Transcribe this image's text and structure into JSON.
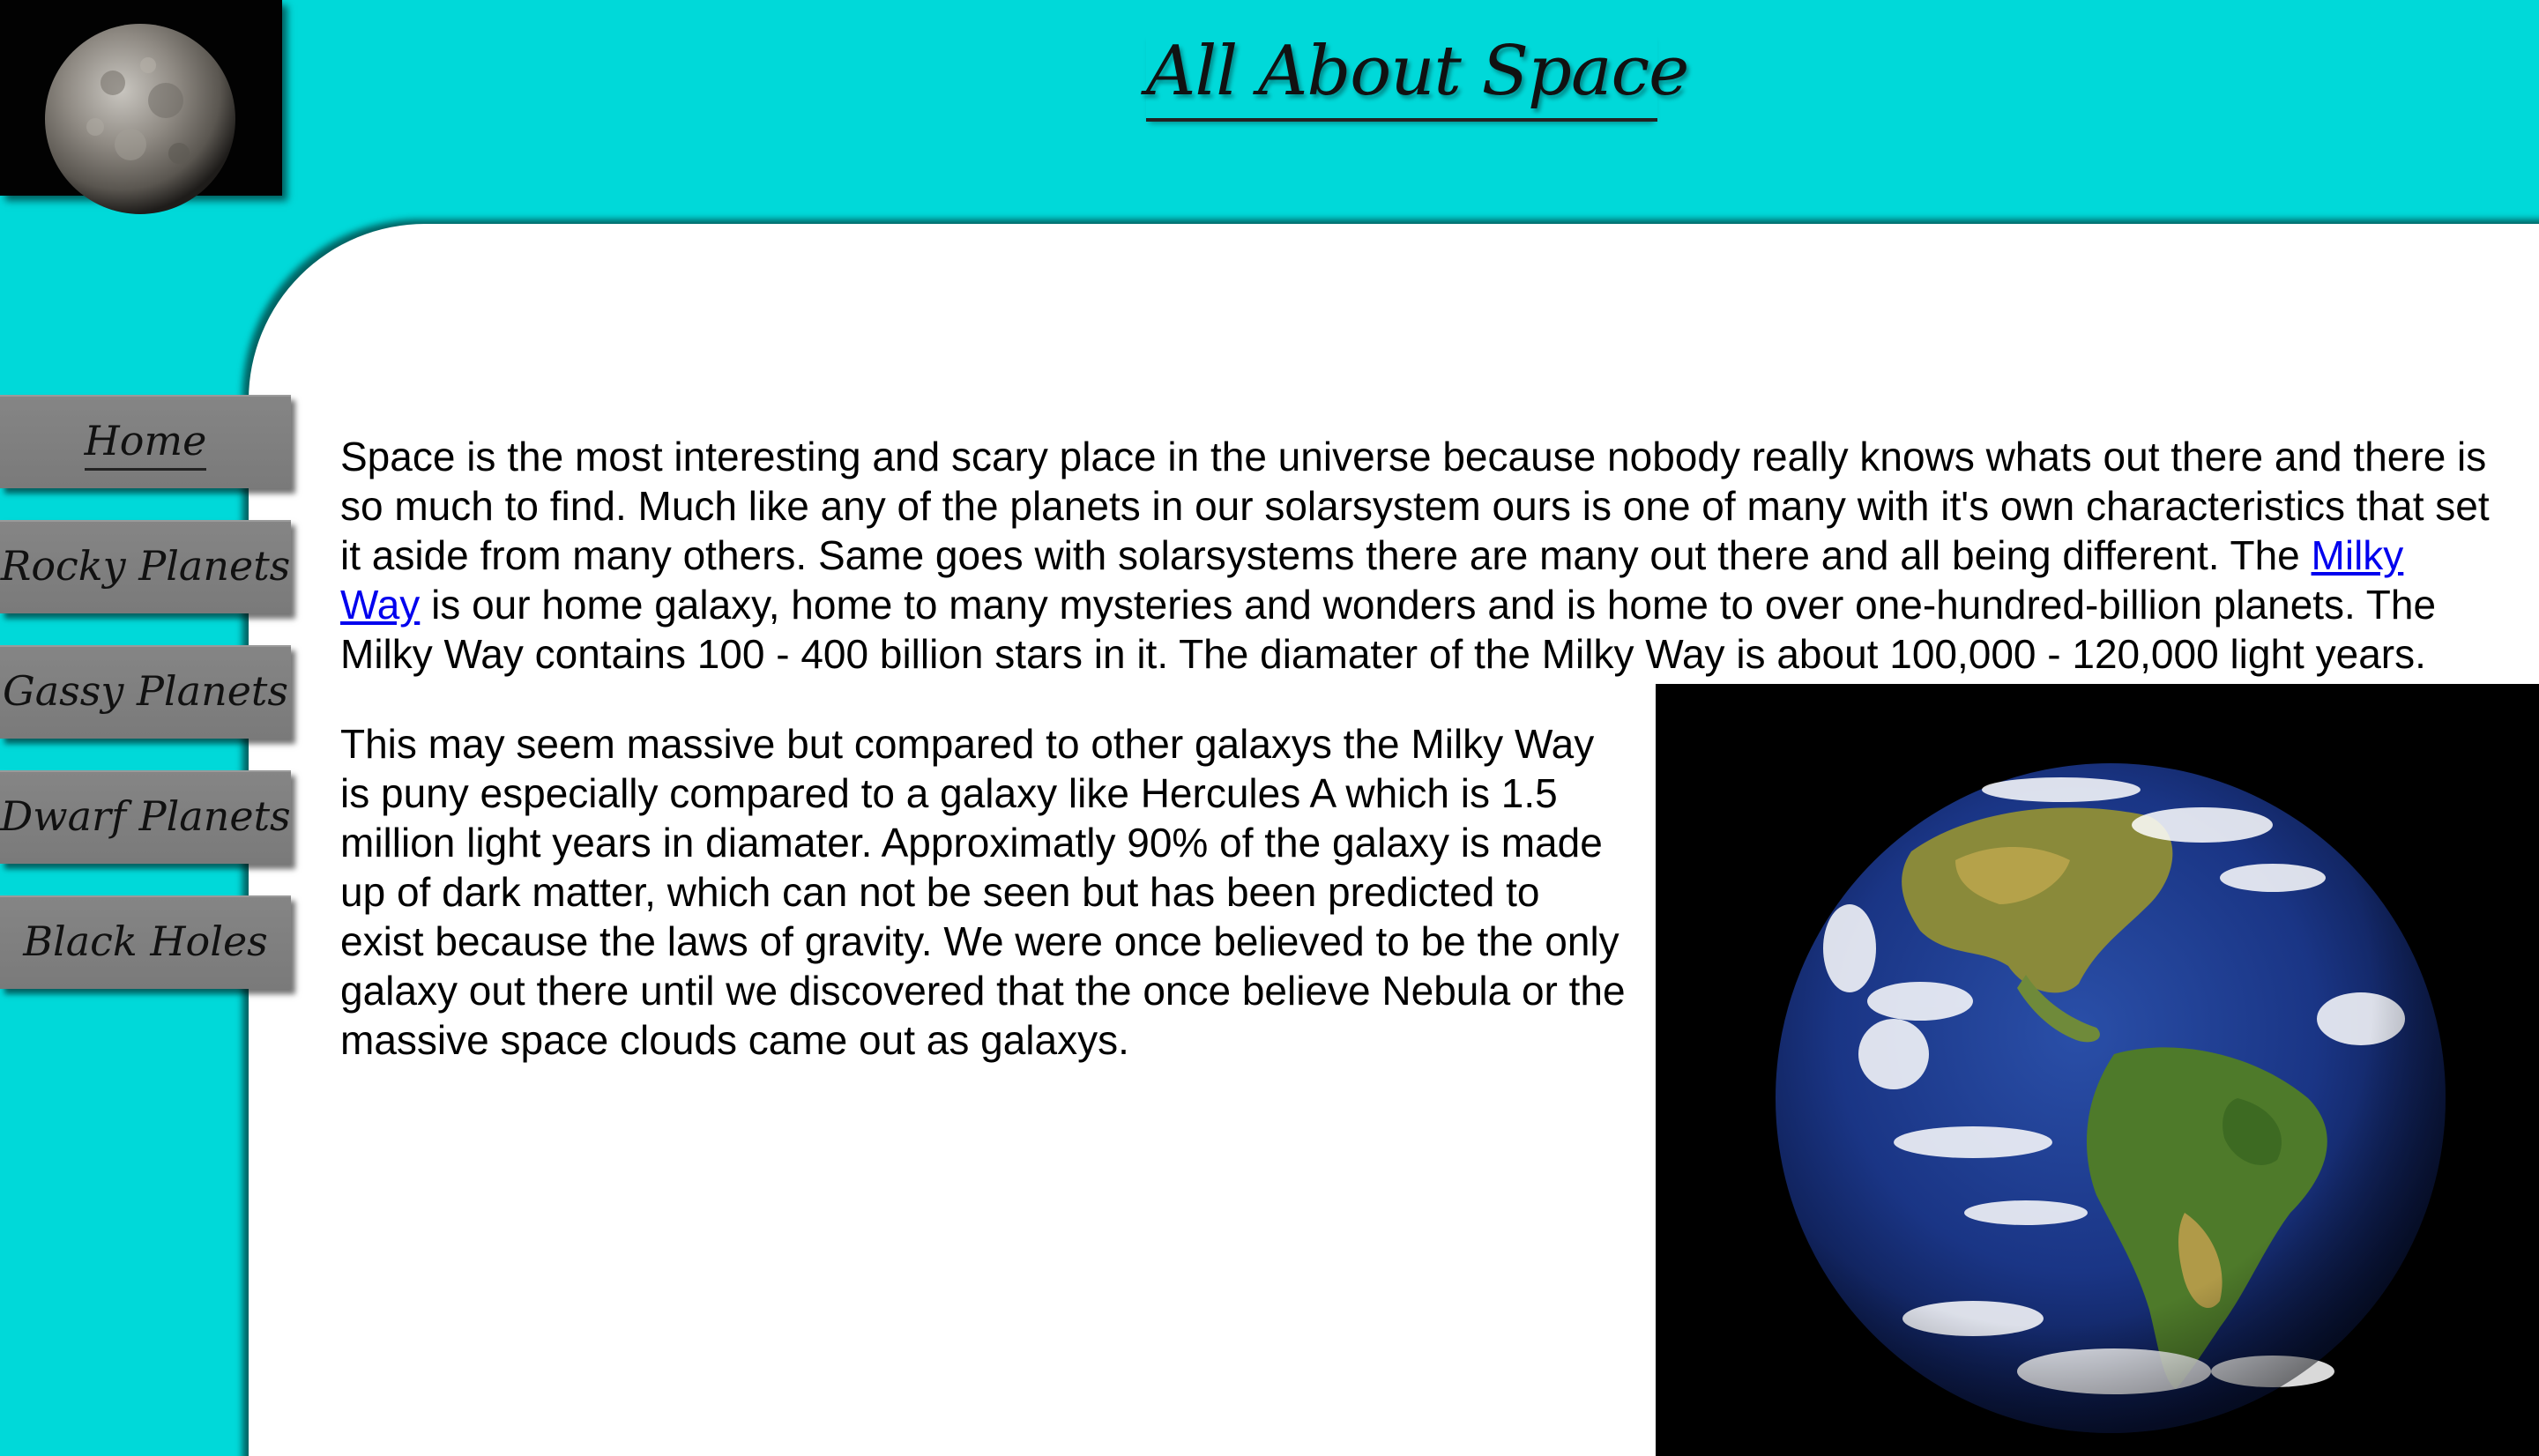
{
  "header": {
    "title": "All About Space"
  },
  "nav": {
    "items": [
      {
        "label": "Home",
        "active": true
      },
      {
        "label": "Rocky Planets",
        "active": false
      },
      {
        "label": "Gassy Planets",
        "active": false
      },
      {
        "label": "Dwarf Planets",
        "active": false
      },
      {
        "label": "Black Holes",
        "active": false
      }
    ]
  },
  "main": {
    "para1_before_link": "Space is the most interesting and scary place in the universe because nobody really knows whats out there and there is so much to find. Much like any of the planets in our solarsystem ours is one of many with it's own characteristics that set it aside from many others. Same goes with solarsystems there are many out there and all being different. The ",
    "link_text": "Milky Way",
    "para1_after_link": " is our home galaxy, home to many mysteries and wonders and is home to over one-hundred-billion planets. The Milky Way contains 100 - 400 billion stars in it. The diamater of the Milky Way is about 100,000 - 120,000 light years.",
    "para2": "This may seem massive but compared to other galaxys the Milky Way is puny especially compared to a galaxy like Hercules A which is 1.5 million light years in diamater. Approximatly 90% of the galaxy is made up of dark matter, which can not be seen but has been predicted to exist because the laws of gravity. We were once believed to be the only galaxy out there until we discovered that the once believe Nebula or the massive space clouds came out as galaxys."
  },
  "colors": {
    "background": "#00d9d9",
    "nav_button": "#808080",
    "link": "#0000ee"
  },
  "icons": {
    "logo": "moon-planet-image",
    "content_image": "earth-image"
  }
}
